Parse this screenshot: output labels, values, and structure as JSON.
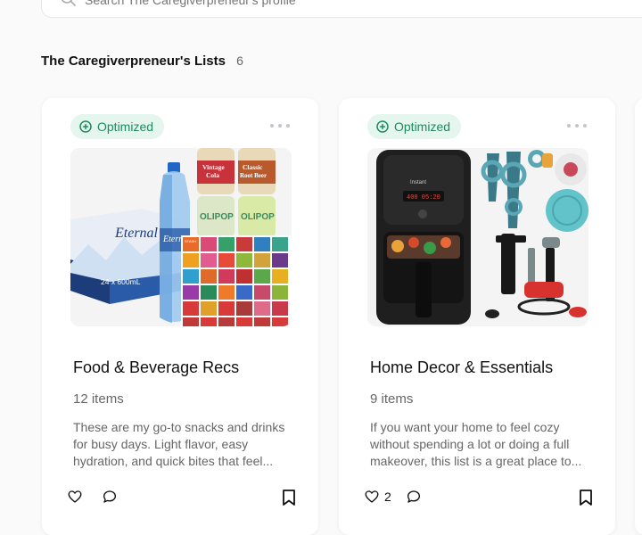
{
  "search": {
    "placeholder": "Search The Caregiverpreneur's profile"
  },
  "section": {
    "title": "The Caregiverpreneur's Lists",
    "count": "6"
  },
  "colors": {
    "badge_bg": "#e4f6ee",
    "badge_text": "#1f8a5b",
    "accent": "#111111"
  },
  "cards": [
    {
      "badge": "Optimized",
      "title": "Food & Beverage Recs",
      "count": "12 items",
      "description": "These are my go-to snacks and drinks for busy days. Light flavor, easy hydration, and quick bites that feel...",
      "likes": "",
      "cover_labels": [
        "Eternal",
        "24 x 600mL",
        "Vintage Cola",
        "Classic Root Beer",
        "OLIPOP",
        "OLIPOP",
        "STASH"
      ],
      "icons": [
        "heart-icon",
        "comment-icon",
        "bookmark-icon",
        "more-icon",
        "check-circle-icon"
      ]
    },
    {
      "badge": "Optimized",
      "title": "Home Decor & Essentials",
      "count": "9 items",
      "description": "If you want your home to feel cozy without spending a lot or doing a full makeover, this list is a great place to...",
      "likes": "2",
      "cover_labels": [
        "Instant",
        "400 05:20"
      ],
      "icons": [
        "heart-icon",
        "comment-icon",
        "bookmark-icon",
        "more-icon",
        "check-circle-icon"
      ]
    }
  ]
}
